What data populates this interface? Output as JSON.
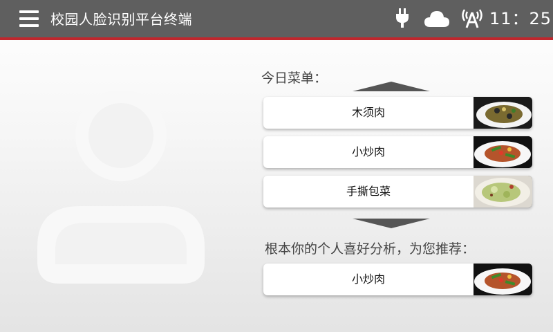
{
  "header": {
    "title": "校园人脸识别平台终端",
    "time": "11：25",
    "icons": [
      "menu-icon",
      "power-plug-icon",
      "cloud-icon",
      "wireless-signal-icon"
    ],
    "bar_color": "#5f5f5f",
    "accent_color": "#c0272d"
  },
  "menu": {
    "label": "今日菜单：",
    "items": [
      {
        "name": "木须肉",
        "photo": "dish-photo-muxurou"
      },
      {
        "name": "小炒肉",
        "photo": "dish-photo-xiaochaorou"
      },
      {
        "name": "手撕包菜",
        "photo": "dish-photo-shousibaocai"
      }
    ]
  },
  "recommend": {
    "label": "根本你的个人喜好分析，为您推荐：",
    "items": [
      {
        "name": "小炒肉",
        "photo": "dish-photo-xiaochaorou"
      }
    ]
  },
  "avatar": {
    "icon": "user-placeholder-icon"
  }
}
